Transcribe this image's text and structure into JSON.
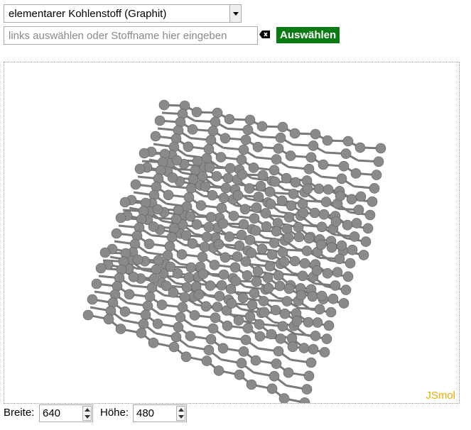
{
  "substance_select": {
    "selected": "elementarer Kohlenstoff (Graphit)"
  },
  "search": {
    "placeholder": "links auswählen oder Stoffname hier eingeben",
    "value": ""
  },
  "submit": {
    "label": "Auswählen"
  },
  "viewer": {
    "logo": "JSmol",
    "logo_color": "#f2a900",
    "atom_color": "#8a8a8a",
    "bond_color": "#7a7a7a"
  },
  "dimensions": {
    "width_label": "Breite:",
    "width_value": "640",
    "height_label": "Höhe:",
    "height_value": "480"
  },
  "icons": {
    "clear": "backspace-icon",
    "dropdown": "chevron-down-icon"
  }
}
